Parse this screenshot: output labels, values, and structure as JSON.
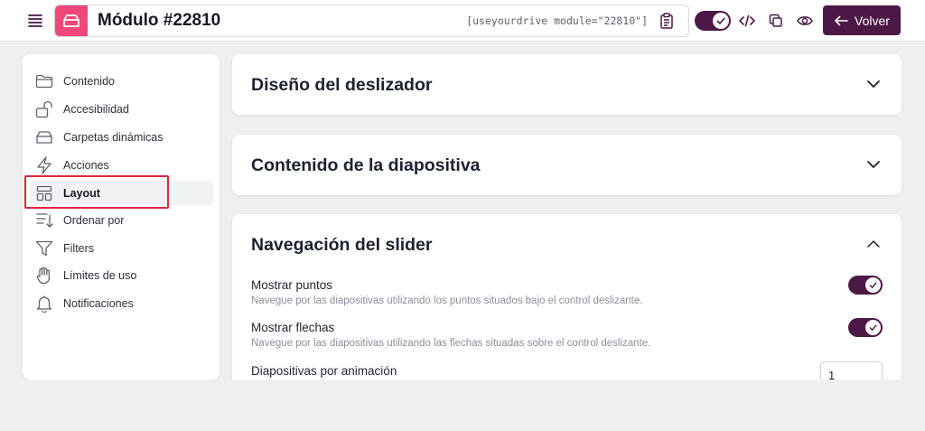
{
  "topbar": {
    "title": "Módulo #22810",
    "shortcode": "[useyourdrive module=\"22810\"]",
    "back_label": "Volver",
    "module_color": "#f0477a",
    "accent_color": "#4c1846"
  },
  "sidebar": {
    "items": [
      {
        "label": "Contenido",
        "icon": "folder-icon"
      },
      {
        "label": "Accesibilidad",
        "icon": "unlock-icon"
      },
      {
        "label": "Carpetas dinámicas",
        "icon": "inbox-icon"
      },
      {
        "label": "Acciones",
        "icon": "bolt-icon"
      },
      {
        "label": "Layout",
        "icon": "layout-icon",
        "active": true
      },
      {
        "label": "Ordenar por",
        "icon": "sort-icon"
      },
      {
        "label": "Filters",
        "icon": "filter-icon"
      },
      {
        "label": "Límites de uso",
        "icon": "hand-icon"
      },
      {
        "label": "Notificaciones",
        "icon": "bell-icon"
      }
    ]
  },
  "panels": {
    "design": {
      "title": "Diseño del deslizador",
      "expanded": false
    },
    "content": {
      "title": "Contenido de la diapositiva",
      "expanded": false
    },
    "navigation": {
      "title": "Navegación del slider",
      "expanded": true,
      "settings": {
        "dots": {
          "label": "Mostrar puntos",
          "desc": "Navegue por las diapositivas utilizando los puntos situados bajo el control deslizante.",
          "enabled": true
        },
        "arrows": {
          "label": "Mostrar flechas",
          "desc": "Navegue por las diapositivas utilizando las flechas situadas sobre el control deslizante.",
          "enabled": true
        },
        "slides_per_animation": {
          "label": "Diapositivas por animación",
          "value": "1"
        }
      }
    }
  }
}
